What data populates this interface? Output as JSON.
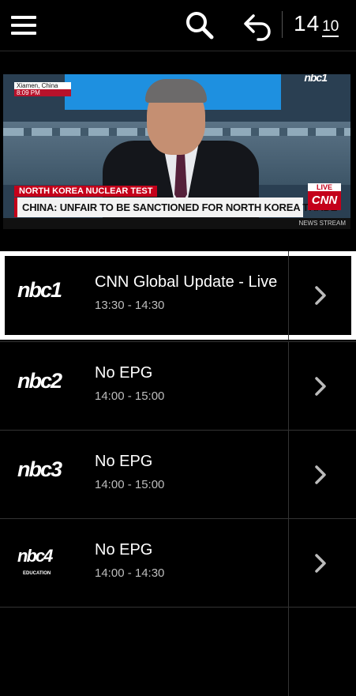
{
  "topbar": {
    "menu_icon": "hamburger-menu-icon",
    "search_icon": "search-icon",
    "back_icon": "back-arrow-icon",
    "clock_hours": "14",
    "clock_minutes": "10"
  },
  "player": {
    "location_line1": "Xiamen, China",
    "location_line2": "8:09 PM",
    "channel_bug": "nbc1",
    "kicker": "NORTH KOREA NUCLEAR TEST",
    "headline": "CHINA: UNFAIR TO BE SANCTIONED FOR NORTH KOREA TRADE",
    "live_label": "LIVE",
    "network_logo": "CNN",
    "ticker_text": "NEWS STREAM"
  },
  "channels": [
    {
      "logo": "nbc1",
      "logo_sub": "",
      "title": "CNN Global Update - Live",
      "time": "13:30 - 14:30",
      "selected": true
    },
    {
      "logo": "nbc2",
      "logo_sub": "",
      "title": "No EPG",
      "time": "14:00 - 15:00",
      "selected": false
    },
    {
      "logo": "nbc3",
      "logo_sub": "",
      "title": "No EPG",
      "time": "14:00 - 15:00",
      "selected": false
    },
    {
      "logo": "nbc4",
      "logo_sub": "EDUCATION",
      "title": "No EPG",
      "time": "14:00 - 14:30",
      "selected": false
    }
  ],
  "colors": {
    "background": "#000000",
    "cnn_red": "#c4001a",
    "selection": "#ffffff"
  }
}
